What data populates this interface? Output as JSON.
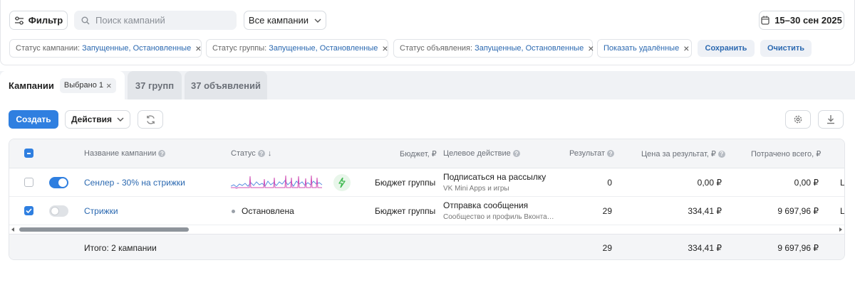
{
  "toolbar": {
    "filter_label": "Фильтр",
    "search_placeholder": "Поиск кампаний",
    "campaigns_select": "Все кампании",
    "date_range": "15–30 сен 2025"
  },
  "chips": [
    {
      "label": "Статус кампании:",
      "value": "Запущенные, Остановленные"
    },
    {
      "label": "Статус группы:",
      "value": "Запущенные, Остановленные"
    },
    {
      "label": "Статус объявления:",
      "value": "Запущенные, Остановленные"
    },
    {
      "label": "",
      "value": "Показать удалённые"
    }
  ],
  "chip_actions": {
    "save": "Сохранить",
    "clear": "Очистить"
  },
  "tabs": {
    "campaigns": "Кампании",
    "selected_badge": "Выбрано 1",
    "groups": "37 групп",
    "ads": "37 объявлений"
  },
  "actions": {
    "create": "Создать",
    "actions_menu": "Действия"
  },
  "table": {
    "headers": {
      "name": "Название кампании",
      "status": "Статус",
      "budget": "Бюджет, ₽",
      "target": "Целевое действие",
      "result": "Результат",
      "price": "Цена за результат, ₽",
      "spent": "Потрачено всего, ₽"
    },
    "rows": [
      {
        "checked": false,
        "enabled": true,
        "name": "Сенлер - 30% на стрижки",
        "status": "",
        "budget": "Бюджет группы",
        "target": "Подписаться на рассылку",
        "target_sub": "VK Mini Apps и игры",
        "result": "0",
        "price": "0,00 ₽",
        "spent": "0,00 ₽",
        "extra": "L"
      },
      {
        "checked": true,
        "enabled": false,
        "name": "Стрижки",
        "status": "Остановлена",
        "budget": "Бюджет группы",
        "target": "Отправка сообщения",
        "target_sub": "Сообщество и профиль Вконта…",
        "result": "29",
        "price": "334,41 ₽",
        "spent": "9 697,96 ₽",
        "extra": "L"
      }
    ],
    "footer": {
      "label": "Итого: 2 кампании",
      "result": "29",
      "price": "334,41 ₽",
      "spent": "9 697,96 ₽"
    }
  },
  "colors": {
    "accent": "#2f7fe0",
    "link": "#2a68b0",
    "sparkline_blue": "#5b8fe0",
    "sparkline_pink": "#d04fb5",
    "lightning_green": "#3fb950"
  }
}
